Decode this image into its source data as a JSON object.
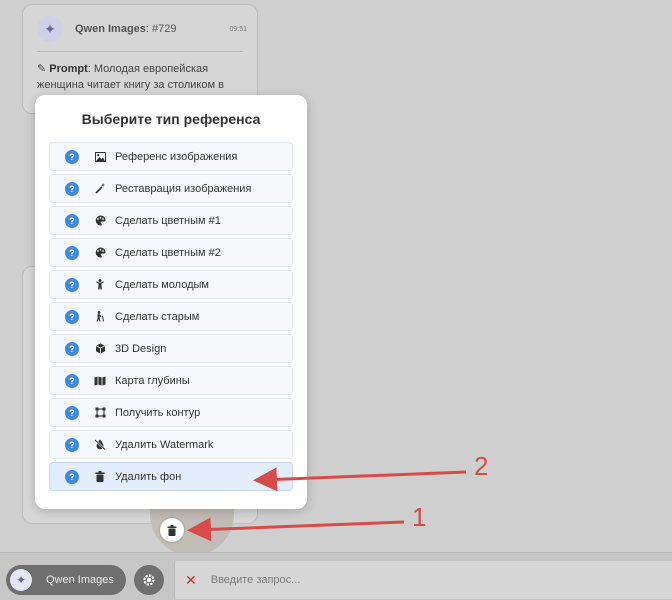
{
  "chat": {
    "bot_name": "Qwen Images",
    "bot_num": ": #729",
    "time": "09:51",
    "prompt_label": "Prompt",
    "prompt_text": ": Молодая европейская женщина читает книгу за столиком в"
  },
  "modal": {
    "title": "Выберите тип референса",
    "options": [
      {
        "label": "Референс изображения",
        "icon": "image-icon"
      },
      {
        "label": "Реставрация изображения",
        "icon": "magic-wand-icon"
      },
      {
        "label": "Сделать цветным #1",
        "icon": "palette-icon"
      },
      {
        "label": "Сделать цветным #2",
        "icon": "palette-icon"
      },
      {
        "label": "Сделать молодым",
        "icon": "child-icon"
      },
      {
        "label": "Сделать старым",
        "icon": "elderly-person-icon"
      },
      {
        "label": "3D Design",
        "icon": "cube-icon"
      },
      {
        "label": "Карта глубины",
        "icon": "map-icon"
      },
      {
        "label": "Получить контур",
        "icon": "vector-square-icon"
      },
      {
        "label": "Удалить Watermark",
        "icon": "tint-slash-icon"
      },
      {
        "label": "Удалить фон",
        "icon": "trash-icon"
      }
    ],
    "selected_index": 10
  },
  "annotations": {
    "label_1": "1",
    "label_2": "2",
    "color": "#d94b4b"
  },
  "bottom_bar": {
    "model_name": "Qwen Images",
    "input_placeholder": "Введите запрос..."
  }
}
